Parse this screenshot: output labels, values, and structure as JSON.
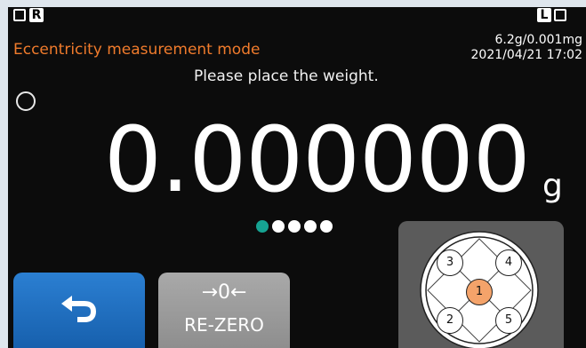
{
  "status": {
    "left_indicator_letter": "R",
    "right_indicator_letter": "L",
    "capacity": "6.2g/0.001mg",
    "datetime": "2021/04/21 17:02"
  },
  "mode": {
    "title": "Eccentricity measurement mode",
    "prompt": "Please place the weight."
  },
  "reading": {
    "value": "0.000000",
    "unit": "g"
  },
  "progress": {
    "total_steps": 5,
    "current_step": 1,
    "active_color": "#16a392"
  },
  "buttons": {
    "back_icon": "return-arrow-icon",
    "rezero_symbol": "→0←",
    "rezero_label": "RE-ZERO"
  },
  "positions": {
    "pan_markers": [
      "1",
      "2",
      "3",
      "4",
      "5"
    ],
    "active_marker": "1",
    "active_color": "#f4a36a"
  }
}
